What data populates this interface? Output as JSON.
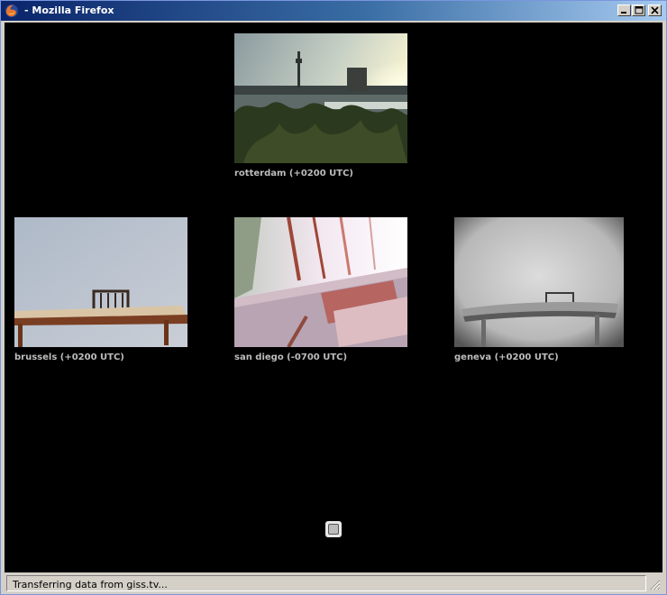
{
  "window": {
    "title": "- Mozilla Firefox",
    "buttons": {
      "minimize": "minimize",
      "maximize": "maximize",
      "close": "close"
    }
  },
  "cams": [
    {
      "label": "rotterdam (+0200 UTC)"
    },
    {
      "label": "brussels (+0200 UTC)"
    },
    {
      "label": "san diego (-0700 UTC)"
    },
    {
      "label": "geneva (+0200 UTC)"
    }
  ],
  "status": {
    "text": "Transferring data from giss.tv..."
  },
  "icons": {
    "app": "firefox-icon",
    "loader": "loading-icon",
    "grip": "resize-grip-icon"
  }
}
